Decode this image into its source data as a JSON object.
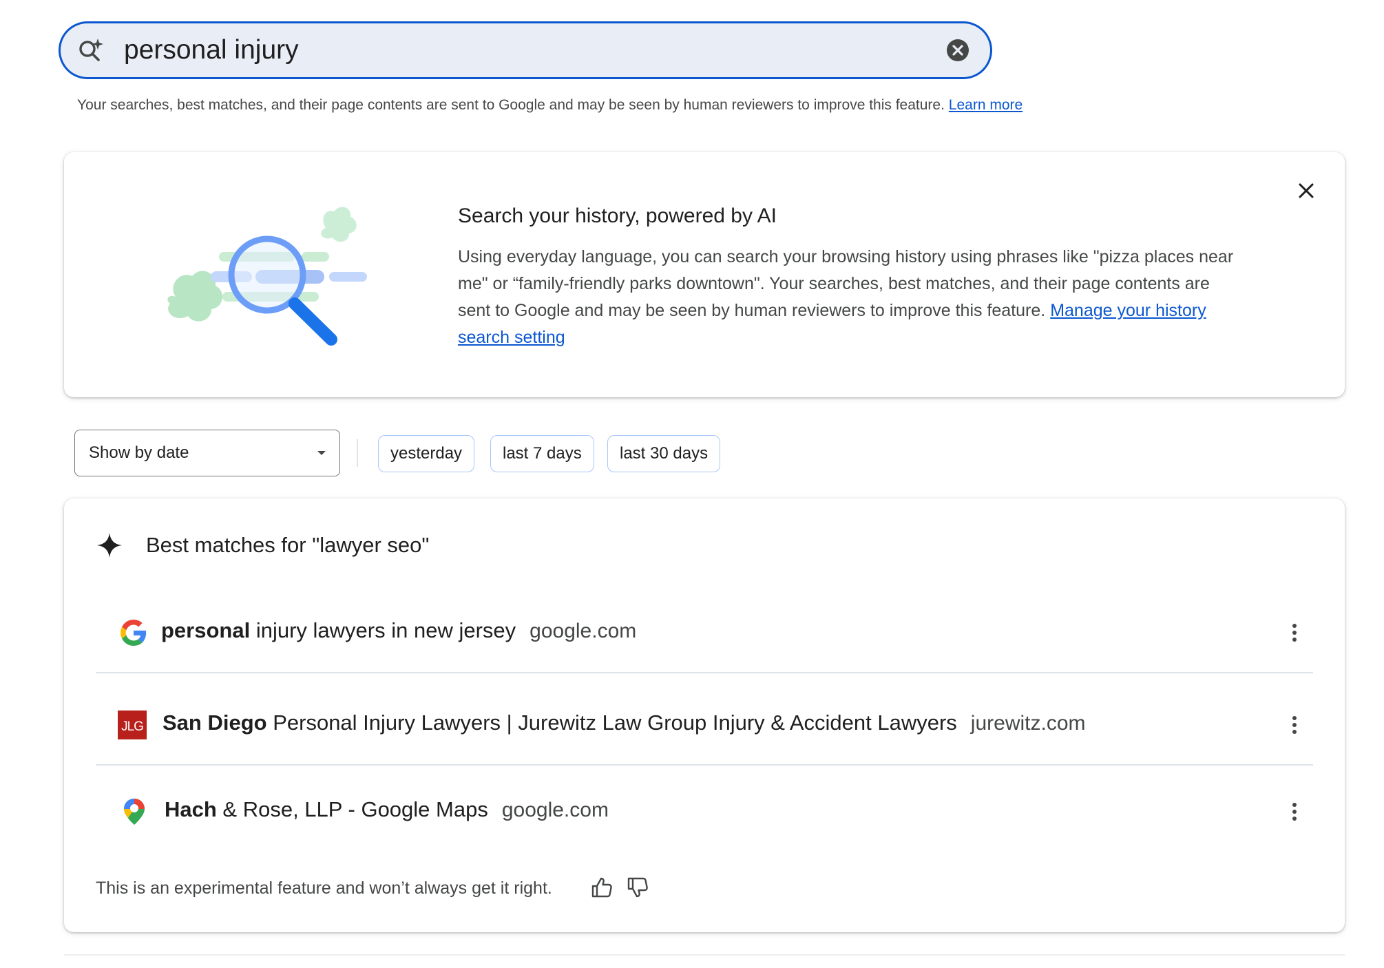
{
  "search": {
    "value": "personal injury",
    "clear_icon": "close-circle-icon",
    "search_icon": "ai-search-sparkle-icon"
  },
  "disclaimer": {
    "text": "Your searches, best matches, and their page contents are sent to Google and may be seen by human reviewers to improve this feature.",
    "link": "Learn more"
  },
  "promo": {
    "title": "Search your history, powered by AI",
    "body": "Using everyday language, you can search your browsing history using phrases like \"pizza places near me\" or “family-friendly parks downtown\". Your searches, best matches, and their page contents are sent to Google and may be seen by human reviewers to improve this feature.",
    "link": "Manage your history search setting"
  },
  "filters": {
    "select_value": "Show by date",
    "chips": [
      "yesterday",
      "last 7 days",
      "last 30 days"
    ]
  },
  "matches": {
    "heading": "Best matches for \"lawyer seo\"",
    "rows": [
      {
        "bold": "personal",
        "rest": " injury lawyers in new jersey",
        "domain": "google.com",
        "icon": "google-g-icon"
      },
      {
        "bold": "San Diego",
        "rest": " Personal Injury Lawyers | Jurewitz Law Group Injury & Accident Lawyers",
        "domain": "jurewitz.com",
        "icon": "jlg-logo-icon",
        "icon_text": "JLG"
      },
      {
        "bold": "Hach",
        "rest": " & Rose, LLP - Google Maps",
        "domain": "google.com",
        "icon": "google-maps-pin-icon"
      }
    ],
    "footer": "This is an experimental feature and won’t always get it right."
  },
  "colors": {
    "accent": "#0b57d0",
    "search_bg": "#e9eef6",
    "chip_border": "#a8c7fa",
    "jlg_red": "#b8201c"
  }
}
